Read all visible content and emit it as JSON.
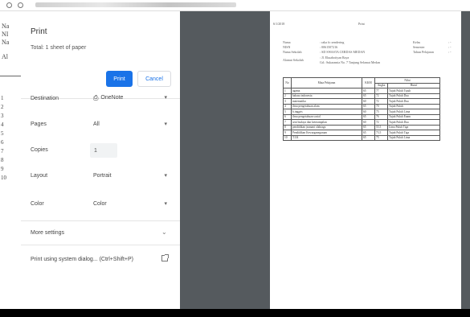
{
  "dialog": {
    "title": "Print",
    "total": "Total: 1 sheet of paper",
    "print_label": "Print",
    "cancel_label": "Cancel",
    "destination": {
      "label": "Destination",
      "value": "OneNote",
      "icon": "printer-icon"
    },
    "pages": {
      "label": "Pages",
      "value": "All"
    },
    "copies": {
      "label": "Copies",
      "value": "1"
    },
    "layout": {
      "label": "Layout",
      "value": "Portrait"
    },
    "color": {
      "label": "Color",
      "value": "Color"
    },
    "more_settings": "More settings",
    "system_dialog": "Print using system dialog... (Ctrl+Shift+P)"
  },
  "underlying": {
    "lines": [
      "Na",
      "NI",
      "Na",
      "Al"
    ],
    "row_numbers": [
      "1",
      "2",
      "3",
      "4",
      "5",
      "6",
      "7",
      "8",
      "9",
      "10"
    ]
  },
  "sheet": {
    "header_left": "6/1/2018",
    "header_center": "Print",
    "info_left": [
      {
        "k": "Nama",
        "v": ": raka fo xendering"
      },
      {
        "k": "NISN",
        "v": ": 0061507216"
      },
      {
        "k": "Nama Sekolah",
        "v": ": SD SWASTA CERDAS MEDAN"
      },
      {
        "k": "Alamat Sekolah",
        "v": ": Jl. Ekuabotiyan Raya"
      },
      {
        "k": "",
        "v": "  Gd.: Sukaramia No. 7 Tanjung Selamat Medan"
      }
    ],
    "info_right": [
      {
        "k": "Kelas",
        "v": ": -"
      },
      {
        "k": "Semester",
        "v": ": -"
      },
      {
        "k": "Tahun Pelajaran",
        "v": ": -"
      }
    ],
    "table_headers": [
      "No",
      "Mata Pelajaran",
      "KKM",
      "Nilai"
    ],
    "sub_headers": [
      "Angka",
      "Huruf"
    ],
    "rows": [
      {
        "no": "1",
        "mapel": "agama",
        "kkm": "65",
        "angka": "77",
        "huruf": "Tujuh Puluh Tujuh"
      },
      {
        "no": "2",
        "mapel": "bahasa indonesia",
        "kkm": "65",
        "angka": "72",
        "huruf": "Tujuh Puluh Dua"
      },
      {
        "no": "3",
        "mapel": "matematika",
        "kkm": "60",
        "angka": "72",
        "huruf": "Tujuh Puluh Dua"
      },
      {
        "no": "4",
        "mapel": "ilmu pengetahuan alam",
        "kkm": "65",
        "angka": "70",
        "huruf": "Tujuh Puluh"
      },
      {
        "no": "5",
        "mapel": "b.inggris",
        "kkm": "60",
        "angka": "75",
        "huruf": "Tujuh Puluh Lima"
      },
      {
        "no": "6",
        "mapel": "ilmu pengetahuan sosial",
        "kkm": "65",
        "angka": "76",
        "huruf": "Tujuh Puluh Enam"
      },
      {
        "no": "7",
        "mapel": "seni budaya dan keterampilan",
        "kkm": "60",
        "angka": "72",
        "huruf": "Tujuh Puluh Dua"
      },
      {
        "no": "8",
        "mapel": "pendidikan jasmani olahraga",
        "kkm": "65",
        "angka": "55.5",
        "huruf": "Lima Puluh Tiga"
      },
      {
        "no": "9",
        "mapel": "Pendidikan Kewarganegaraan",
        "kkm": "65",
        "angka": "73.5",
        "huruf": "Tujuh Puluh Tiga"
      },
      {
        "no": "10",
        "mapel": "T.I.K",
        "kkm": "65",
        "angka": "75",
        "huruf": "Tujuh Puluh Lima"
      }
    ]
  }
}
